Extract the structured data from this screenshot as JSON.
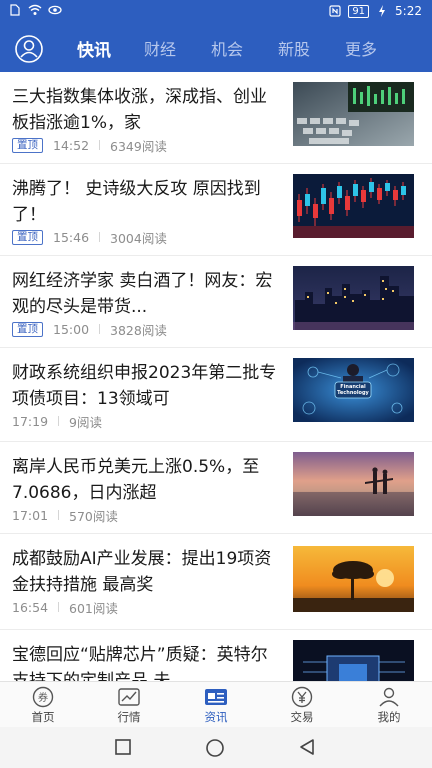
{
  "status_bar": {
    "time": "5:22",
    "battery": "91",
    "left_icons": [
      "sim-icon",
      "wifi-icon",
      "eye-icon"
    ],
    "right_icons": [
      "nfc-icon",
      "battery-icon",
      "charging-icon"
    ]
  },
  "top_nav": {
    "tabs": [
      {
        "label": "快讯",
        "active": true
      },
      {
        "label": "财经",
        "active": false
      },
      {
        "label": "机会",
        "active": false
      },
      {
        "label": "新股",
        "active": false
      },
      {
        "label": "更多",
        "active": false
      }
    ]
  },
  "feed": {
    "items": [
      {
        "title": "三大指数集体收涨，深成指、创业板指涨逾1%，家",
        "badge": "置顶",
        "time": "14:52",
        "reads": "6349阅读",
        "image": "keyboard-trading-image"
      },
      {
        "title": "沸腾了！ 史诗级大反攻 原因找到了！",
        "badge": "置顶",
        "time": "15:46",
        "reads": "3004阅读",
        "image": "candlestick-chart-image"
      },
      {
        "title": "网红经济学家 卖白酒了！网友：宏观的尽头是带货...",
        "badge": "置顶",
        "time": "15:00",
        "reads": "3828阅读",
        "image": "city-night-image"
      },
      {
        "title": "财政系统组织申报2023年第二批专项债项目：13领域可",
        "badge": "",
        "time": "17:19",
        "reads": "9阅读",
        "image": "financial-technology-image"
      },
      {
        "title": "离岸人民币兑美元上涨0.5%，至7.0686，日内涨超",
        "badge": "",
        "time": "17:01",
        "reads": "570阅读",
        "image": "beach-sunset-image"
      },
      {
        "title": "成都鼓励AI产业发展：提出19项资金扶持措施 最高奖",
        "badge": "",
        "time": "16:54",
        "reads": "601阅读",
        "image": "tree-sunset-image"
      },
      {
        "title": "宝德回应“贴牌芯片”质疑：英特尔支持下的定制产品 未",
        "badge": "",
        "time": "",
        "reads": "",
        "image": "chip-image"
      }
    ],
    "image_text": "Financial Technology"
  },
  "bottom_nav": {
    "items": [
      {
        "label": "首页",
        "icon": "home-coupon-icon",
        "active": false
      },
      {
        "label": "行情",
        "icon": "market-chart-icon",
        "active": false
      },
      {
        "label": "资讯",
        "icon": "news-icon",
        "active": true
      },
      {
        "label": "交易",
        "icon": "trade-yuan-icon",
        "active": false
      },
      {
        "label": "我的",
        "icon": "profile-icon",
        "active": false
      }
    ]
  },
  "colors": {
    "brand": "#2d5ebf",
    "badge": "#3b63c0",
    "text": "#1a1a1a",
    "meta": "#8d8d8d"
  }
}
